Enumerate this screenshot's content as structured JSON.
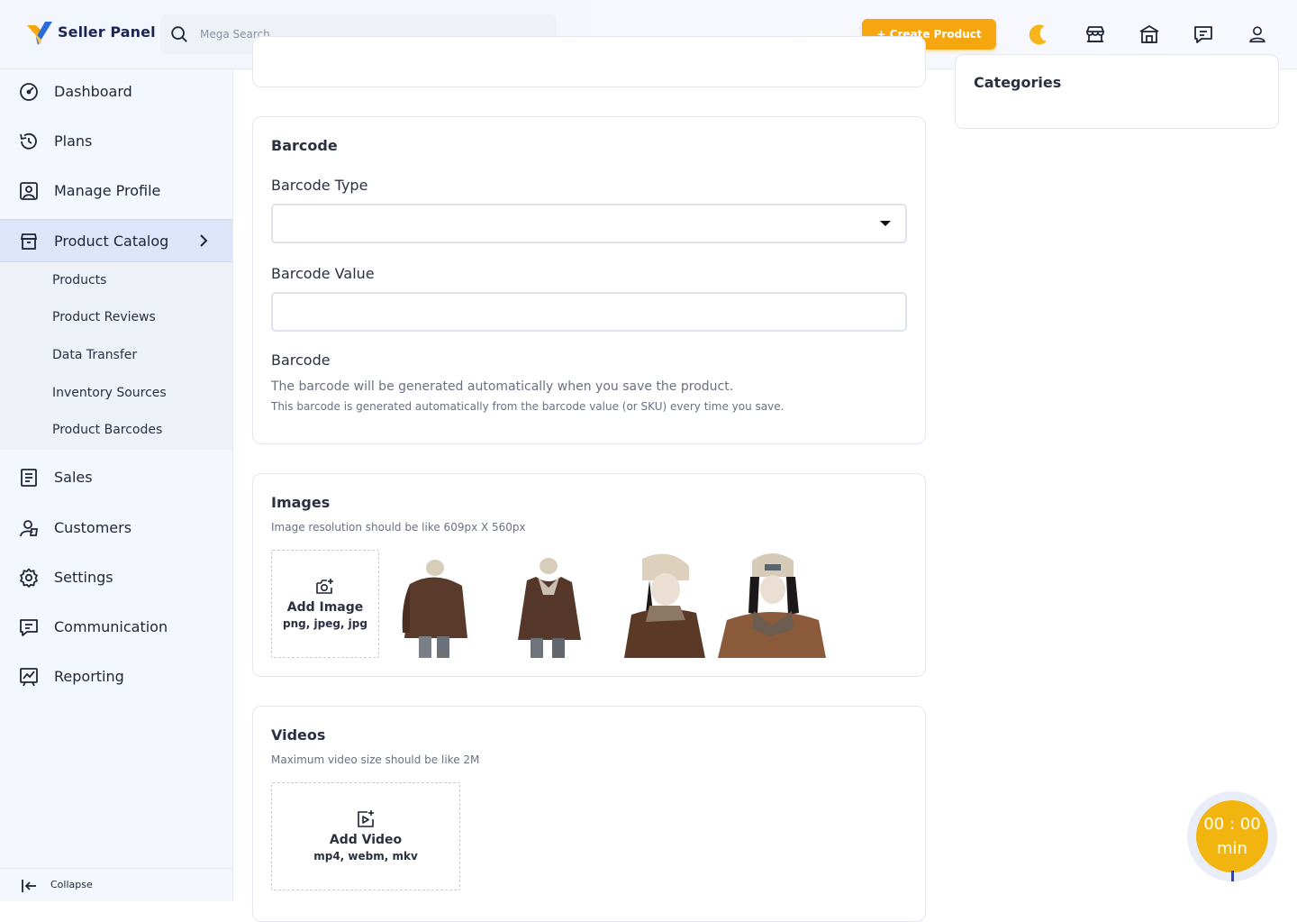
{
  "header": {
    "brand": "Seller Panel",
    "search_placeholder": "Mega Search",
    "create_button": "+ Create Product",
    "icons": [
      "moon-icon",
      "store-icon",
      "shop-icon",
      "chat-icon",
      "user-icon"
    ]
  },
  "sidebar": {
    "items": [
      {
        "label": "Dashboard",
        "icon": "dashboard-icon"
      },
      {
        "label": "Plans",
        "icon": "history-icon"
      },
      {
        "label": "Manage Profile",
        "icon": "profile-icon"
      },
      {
        "label": "Product Catalog",
        "icon": "catalog-icon",
        "active": true
      },
      {
        "label": "Sales",
        "icon": "document-icon"
      },
      {
        "label": "Customers",
        "icon": "customers-icon"
      },
      {
        "label": "Settings",
        "icon": "gear-icon"
      },
      {
        "label": "Communication",
        "icon": "chat-icon"
      },
      {
        "label": "Reporting",
        "icon": "chart-icon"
      }
    ],
    "sub_items": [
      "Products",
      "Product Reviews",
      "Data Transfer",
      "Inventory Sources",
      "Product Barcodes"
    ],
    "collapse_label": "Collapse"
  },
  "barcode": {
    "title": "Barcode",
    "type_label": "Barcode Type",
    "type_value": "",
    "value_label": "Barcode Value",
    "value_value": "",
    "barcode_label": "Barcode",
    "help_main": "The barcode will be generated automatically when you save the product.",
    "help_sub": "This barcode is generated automatically from the barcode value (or SKU) every time you save."
  },
  "images": {
    "title": "Images",
    "caption": "Image resolution should be like 609px X 560px",
    "add_label": "Add Image",
    "formats": "png, jpeg, jpg"
  },
  "videos": {
    "title": "Videos",
    "caption": "Maximum video size should be like 2M",
    "add_label": "Add Video",
    "formats": "mp4, webm, mkv"
  },
  "side": {
    "categories_title": "Categories"
  },
  "timer": {
    "time": "00 : 00",
    "unit": "min"
  },
  "colors": {
    "accent": "#f6a710",
    "sidebar_active": "#dde5fb",
    "brand_text": "#1b2550"
  }
}
